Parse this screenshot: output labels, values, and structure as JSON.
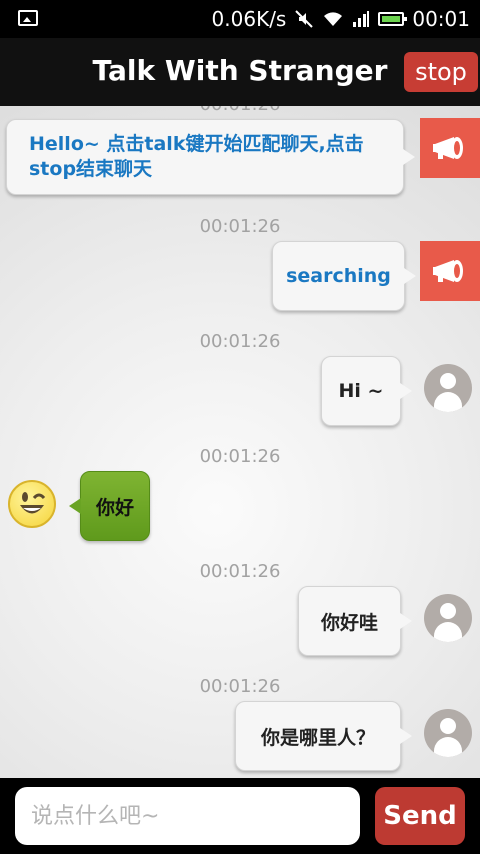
{
  "status_bar": {
    "speed": "0.06K/s",
    "time": "00:01"
  },
  "header": {
    "title": "Talk With Stranger",
    "stop_label": "stop"
  },
  "messages": [
    {
      "timestamp": "00:01:26",
      "text": "Hello~ 点击talk键开始匹配聊天,点击stop结束聊天"
    },
    {
      "timestamp": "00:01:26",
      "text": "searching"
    },
    {
      "timestamp": "00:01:26",
      "text": "Hi ~"
    },
    {
      "timestamp": "00:01:26",
      "text": "你好"
    },
    {
      "timestamp": "00:01:26",
      "text": "你好哇"
    },
    {
      "timestamp": "00:01:26",
      "text": "你是哪里人？"
    }
  ],
  "composer": {
    "placeholder": "说点什么吧~",
    "send_label": "Send"
  },
  "colors": {
    "system_bubble_text": "#1a78c2",
    "megaphone_bg": "#e85a4a",
    "stop_button": "#c73d34",
    "send_button": "#bd3a32",
    "stranger_bubble": "#6aa424"
  },
  "icons": {
    "system": "megaphone-icon",
    "self": "user-avatar-icon",
    "stranger": "wink-emoji-icon"
  }
}
